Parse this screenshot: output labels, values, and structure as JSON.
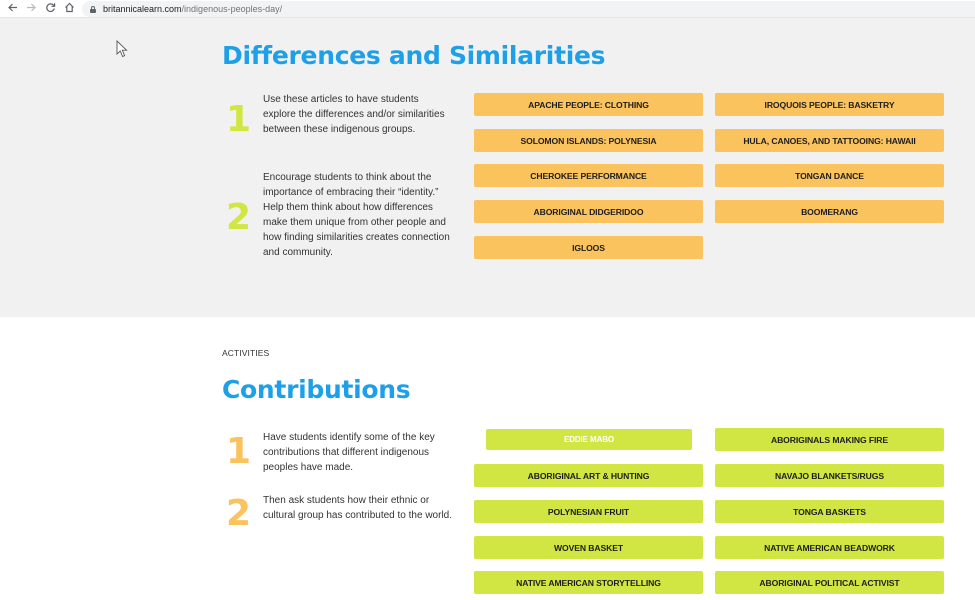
{
  "browser": {
    "back_icon": "arrow-left-icon",
    "forward_icon": "arrow-right-icon",
    "reload_icon": "reload-icon",
    "home_icon": "home-icon",
    "url_domain": "britannicalearn.com",
    "url_path": "/indigenous-peoples-day/"
  },
  "colors": {
    "heading_blue": "#1ea0e8",
    "orange_button": "#fbc35e",
    "green_button": "#d2e643",
    "gray_section": "#f1f1f1"
  },
  "differences": {
    "title": "Differences and Similarities",
    "steps": [
      {
        "number": "1",
        "text": "Use these articles to have students explore the differences and/or similarities between these indigenous groups."
      },
      {
        "number": "2",
        "text": "Encourage students to think about the importance of embracing their “identity.” Help them think about how differences make them unique from other people and how finding similarities creates connection and community."
      }
    ],
    "buttons": [
      "APACHE PEOPLE: CLOTHING",
      "IROQUOIS PEOPLE: BASKETRY",
      "SOLOMON ISLANDS: POLYNESIA",
      "HULA, CANOES, AND TATTOOING: HAWAII",
      "CHEROKEE PERFORMANCE",
      "TONGAN DANCE",
      "ABORIGINAL DIDGERIDOO",
      "BOOMERANG",
      "IGLOOS"
    ]
  },
  "contributions": {
    "eyebrow": "ACTIVITIES",
    "title": "Contributions",
    "steps": [
      {
        "number": "1",
        "text": "Have students identify some of the key contributions that different indigenous peoples have made."
      },
      {
        "number": "2",
        "text": "Then ask students how their ethnic or cultural group has contributed to the world."
      }
    ],
    "buttons": [
      "EDDIE MABO",
      "ABORIGINALS MAKING FIRE",
      "ABORIGINAL ART & HUNTING",
      "NAVAJO BLANKETS/RUGS",
      "POLYNESIAN FRUIT",
      "TONGA BASKETS",
      "WOVEN BASKET",
      "NATIVE AMERICAN BEADWORK",
      "NATIVE AMERICAN STORYTELLING",
      "ABORIGINAL POLITICAL ACTIVIST"
    ],
    "hovered_button": "EDDIE MABO"
  }
}
